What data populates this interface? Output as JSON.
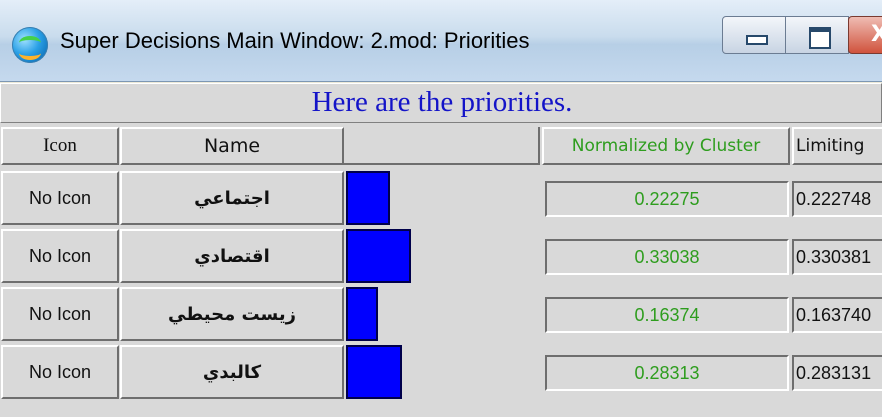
{
  "window": {
    "title": "Super Decisions Main Window: 2.mod: Priorities",
    "app_icon": "super-decisions-icon",
    "buttons": [
      "minimize-icon",
      "maximize-icon",
      "close-icon"
    ]
  },
  "heading": "Here are the priorities.",
  "columns": {
    "icon": "Icon",
    "name": "Name",
    "normalized": "Normalized by Cluster",
    "limiting": "Limiting"
  },
  "colors": {
    "heading": "#1414c8",
    "normalized_text": "#2e9d1e",
    "bar": "#0000ff"
  },
  "rows": [
    {
      "icon": "No Icon",
      "name": "اجتماعي",
      "normalized": "0.22275",
      "limiting": "0.222748",
      "value": 0.22275
    },
    {
      "icon": "No Icon",
      "name": "اقتصادي",
      "normalized": "0.33038",
      "limiting": "0.330381",
      "value": 0.33038
    },
    {
      "icon": "No Icon",
      "name": "زيست محيطي",
      "normalized": "0.16374",
      "limiting": "0.163740",
      "value": 0.16374
    },
    {
      "icon": "No Icon",
      "name": "كالبدي",
      "normalized": "0.28313",
      "limiting": "0.283131",
      "value": 0.28313
    }
  ]
}
